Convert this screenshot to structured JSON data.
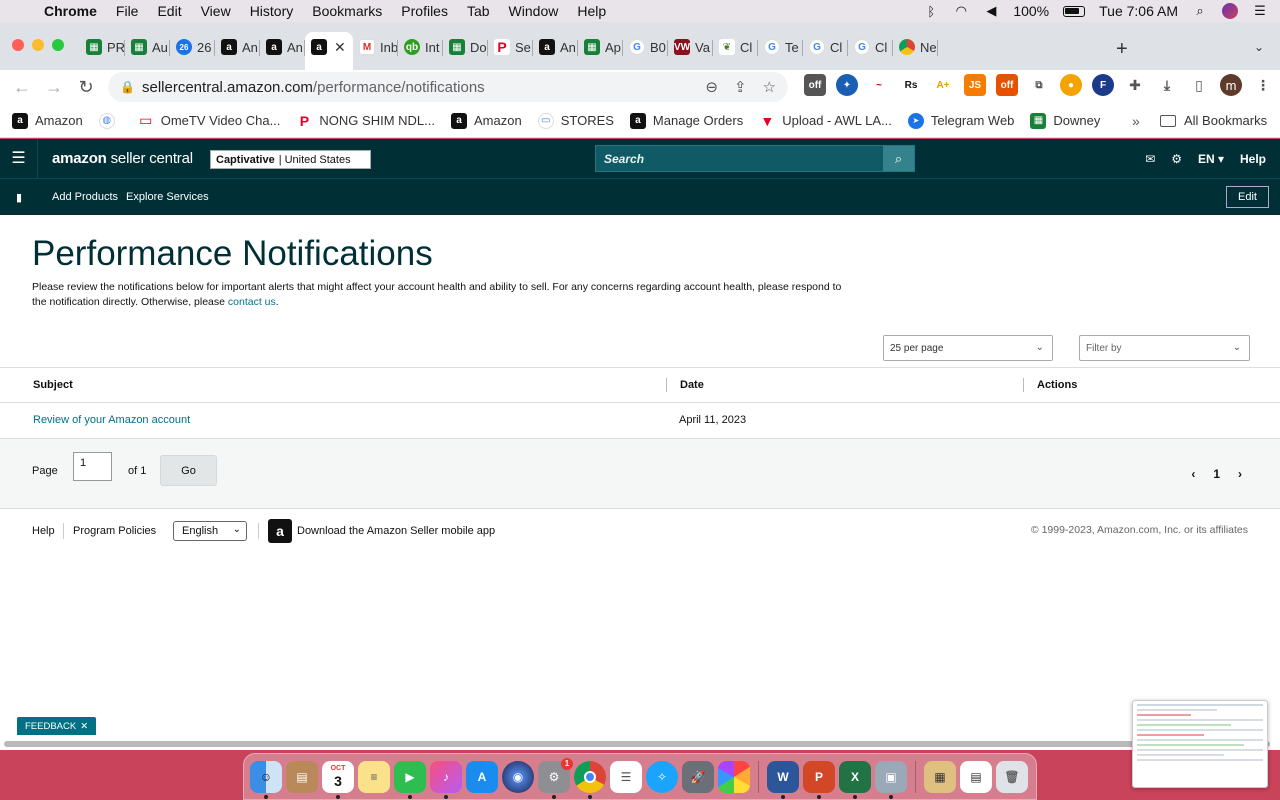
{
  "menubar": {
    "app": "Chrome",
    "items": [
      "File",
      "Edit",
      "View",
      "History",
      "Bookmarks",
      "Profiles",
      "Tab",
      "Window",
      "Help"
    ],
    "battery": "100%",
    "clock": "Tue 7:06 AM"
  },
  "tabs": [
    {
      "label": "PR",
      "icon": "sheets-icon"
    },
    {
      "label": "Au",
      "icon": "sheets-icon"
    },
    {
      "label": "26",
      "icon": "calendar-icon"
    },
    {
      "label": "An",
      "icon": "amazon-icon"
    },
    {
      "label": "An",
      "icon": "amazon-icon"
    },
    {
      "label": "",
      "icon": "amazon-icon",
      "active": true
    },
    {
      "label": "Inb",
      "icon": "gmail-icon"
    },
    {
      "label": "Int",
      "icon": "quickbooks-icon"
    },
    {
      "label": "Do",
      "icon": "sheets-icon"
    },
    {
      "label": "Se",
      "icon": "pinterest-icon"
    },
    {
      "label": "An",
      "icon": "amazon-icon"
    },
    {
      "label": "Ap",
      "icon": "sheets-icon"
    },
    {
      "label": "B0",
      "icon": "google-icon"
    },
    {
      "label": "Va",
      "icon": "vw-icon"
    },
    {
      "label": "Cl",
      "icon": "plant-icon"
    },
    {
      "label": "Te",
      "icon": "google-icon"
    },
    {
      "label": "Cl",
      "icon": "google-icon"
    },
    {
      "label": "Cl",
      "icon": "google-icon"
    },
    {
      "label": "Ne",
      "icon": "chrome-icon"
    }
  ],
  "omnibox": {
    "host": "sellercentral.amazon.com",
    "path": "/performance/notifications"
  },
  "bookmarks": [
    {
      "label": "Amazon",
      "icon": "amazon-icon"
    },
    {
      "label": "",
      "icon": "globe-icon"
    },
    {
      "label": "OmeTV Video Cha...",
      "icon": "tv-icon"
    },
    {
      "label": "NONG SHIM NDL...",
      "icon": "pinterest-icon"
    },
    {
      "label": "Amazon",
      "icon": "amazon-icon"
    },
    {
      "label": "STORES",
      "icon": "folder-icon"
    },
    {
      "label": "Manage Orders",
      "icon": "amazon-icon"
    },
    {
      "label": "Upload - AWL LA...",
      "icon": "awl-icon"
    },
    {
      "label": "Telegram Web",
      "icon": "telegram-icon"
    },
    {
      "label": "Downey",
      "icon": "sheets-icon"
    }
  ],
  "bookmarks_all": "All Bookmarks",
  "seller": {
    "logo_brand": "amazon",
    "logo_rest": "seller central",
    "store_name": "Captivative",
    "store_region": "United States",
    "search_placeholder": "Search",
    "lang": "EN",
    "help": "Help",
    "nav_links": [
      "Add Products",
      "Explore Services"
    ],
    "edit": "Edit"
  },
  "main": {
    "title": "Performance Notifications",
    "desc_part1": "Please review the notifications below for important alerts that might affect your account health and ability to sell. For any concerns regarding account health, please respond to the notification directly. Otherwise, please ",
    "desc_link": "contact us",
    "desc_end": ".",
    "per_page": "25 per page",
    "filter_placeholder": "Filter by",
    "columns": [
      "Subject",
      "Date",
      "Actions"
    ],
    "rows": [
      {
        "subject": "Review of your Amazon account",
        "date": "April 11, 2023",
        "actions": ""
      }
    ],
    "pager": {
      "page_label": "Page",
      "page_value": "1",
      "of_label": "of 1",
      "go": "Go",
      "current": "1"
    }
  },
  "footer": {
    "help": "Help",
    "policies": "Program Policies",
    "language": "English",
    "app_text": "Download the Amazon Seller mobile app",
    "copyright": "© 1999-2023, Amazon.com, Inc. or its affiliates"
  },
  "feedback": "FEEDBACK",
  "dock": {
    "calendar_month": "OCT",
    "calendar_day": "3",
    "settings_badge": "1"
  },
  "colors": {
    "seller_header": "#002f36",
    "link": "#007185",
    "desktop": "#c9435a"
  }
}
